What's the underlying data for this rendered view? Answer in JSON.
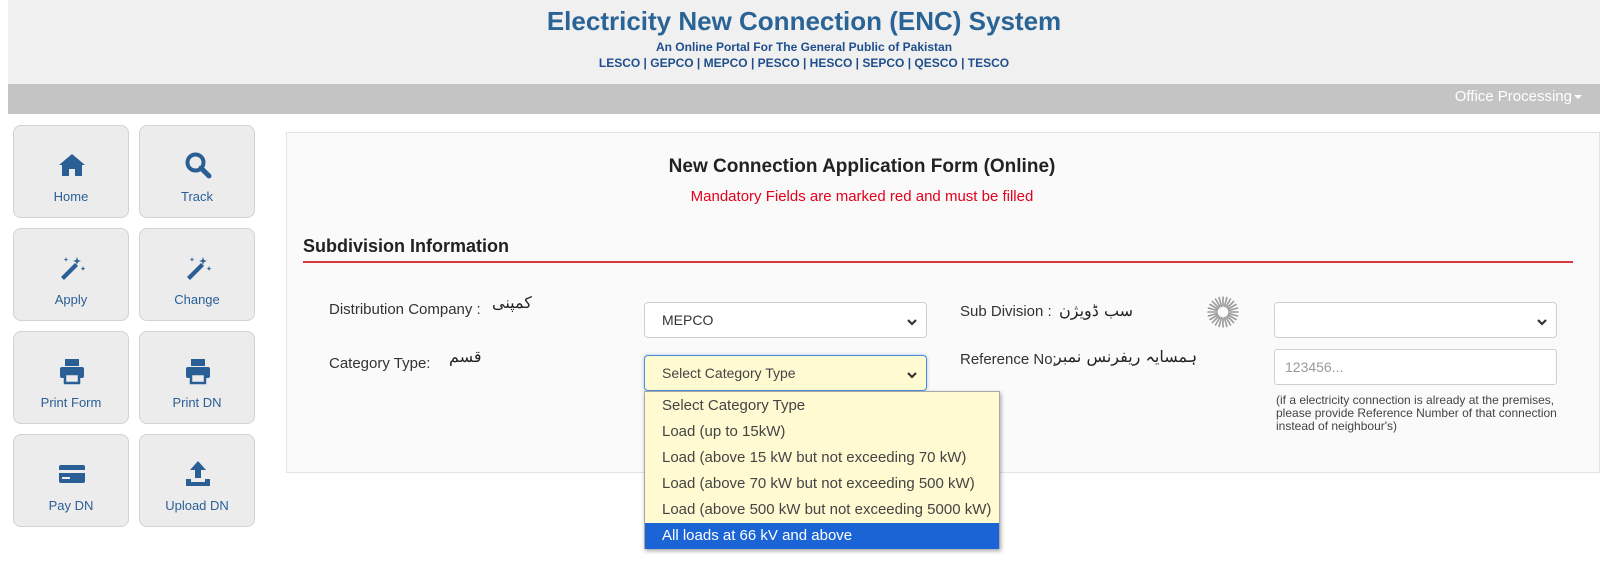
{
  "header": {
    "title": "Electricity New Connection (ENC) System",
    "subtitle": "An Online Portal For The General Public of Pakistan",
    "companies": "LESCO | GEPCO | MEPCO | PESCO | HESCO | SEPCO | QESCO | TESCO"
  },
  "navbar": {
    "menu_label": "Office Processing"
  },
  "tiles": [
    {
      "label": "Home",
      "icon": "home-icon"
    },
    {
      "label": "Track",
      "icon": "search-icon"
    },
    {
      "label": "Apply",
      "icon": "magic-wand-icon"
    },
    {
      "label": "Change",
      "icon": "magic-wand-icon"
    },
    {
      "label": "Print Form",
      "icon": "printer-icon"
    },
    {
      "label": "Print DN",
      "icon": "printer-icon"
    },
    {
      "label": "Pay DN",
      "icon": "credit-card-icon"
    },
    {
      "label": "Upload DN",
      "icon": "upload-icon"
    }
  ],
  "form": {
    "title": "New Connection Application Form (Online)",
    "mandatory_note": "Mandatory Fields are marked red and must be filled",
    "section_title": "Subdivision Information",
    "distribution_company": {
      "label": "Distribution Company :",
      "urdu": "کمپنی",
      "value": "MEPCO"
    },
    "category_type": {
      "label": "Category Type:",
      "urdu": "قسم",
      "value": "Select Category Type"
    },
    "sub_division": {
      "label": "Sub Division :",
      "urdu": "سب ڈویژن",
      "value": ""
    },
    "reference_no": {
      "label": "Reference No:",
      "urdu": "ہمسایہ ریفرنس نمبر",
      "placeholder": "123456...",
      "hint": "(if a electricity connection is already at the premises, please provide Reference Number of that connection instead of neighbour's)"
    }
  },
  "category_options": [
    "Select Category Type",
    "Load (up to 15kW)",
    "Load (above 15 kW but not exceeding 70 kW)",
    "Load (above 70 kW but not exceeding 500 kW)",
    "Load (above 500 kW but not exceeding 5000 kW)",
    "All loads at 66 kV and above"
  ],
  "highlighted_option": "All loads at 66 kV and above",
  "colors": {
    "brand_blue": "#2a6496",
    "accent_red": "#d9363e",
    "highlight_blue": "#1a64d6",
    "select_yellow": "#fffad2"
  }
}
